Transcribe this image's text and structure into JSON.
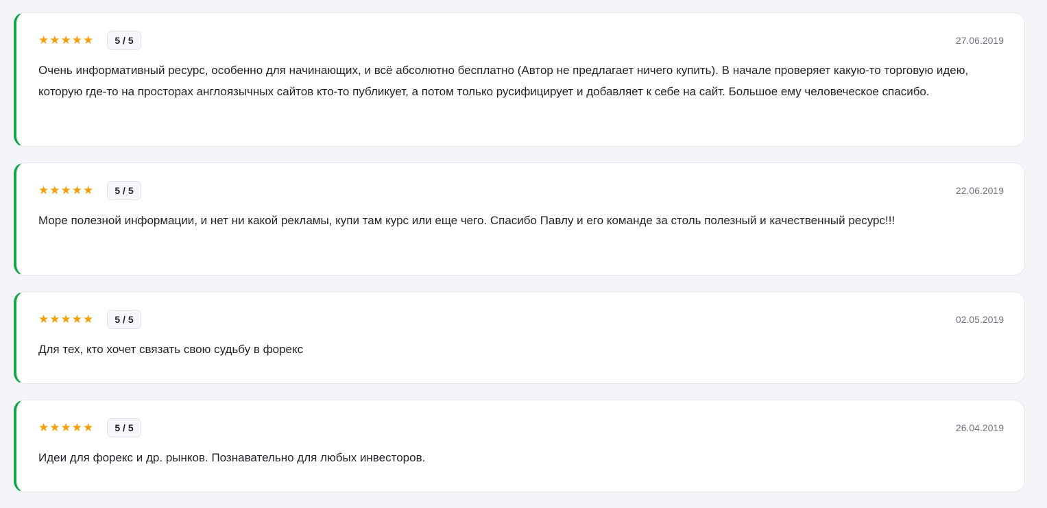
{
  "colors": {
    "background": "#f3f5f9",
    "card": "#ffffff",
    "accent_border": "#16a34a",
    "stars": "#f59e0b",
    "date_text": "#6b7280"
  },
  "reviews": [
    {
      "stars": "★★★★★",
      "star_icon": "star-icon",
      "score": "5 / 5",
      "date": "27.06.2019",
      "text": "Очень информативный ресурс, особенно для начинающих, и всё абсолютно бесплатно (Автор не предлагает ничего купить). В начале проверяет какую-то торговую идею, которую где-то на просторах англоязычных сайтов кто-то публикует, а потом только русифицирует и добавляет к себе на сайт. Большое ему человеческое спасибо."
    },
    {
      "stars": "★★★★★",
      "star_icon": "star-icon",
      "score": "5 / 5",
      "date": "22.06.2019",
      "text": "Море полезной информации, и нет ни какой рекламы, купи там курс или еще чего. Спасибо Павлу и его команде за столь полезный и качественный ресурс!!!"
    },
    {
      "stars": "★★★★★",
      "star_icon": "star-icon",
      "score": "5 / 5",
      "date": "02.05.2019",
      "text": "Для тех, кто хочет связать свою судьбу в форекс"
    },
    {
      "stars": "★★★★★",
      "star_icon": "star-icon",
      "score": "5 / 5",
      "date": "26.04.2019",
      "text": "Идеи для форекс и др. рынков. Познавательно для любых инвесторов."
    }
  ]
}
